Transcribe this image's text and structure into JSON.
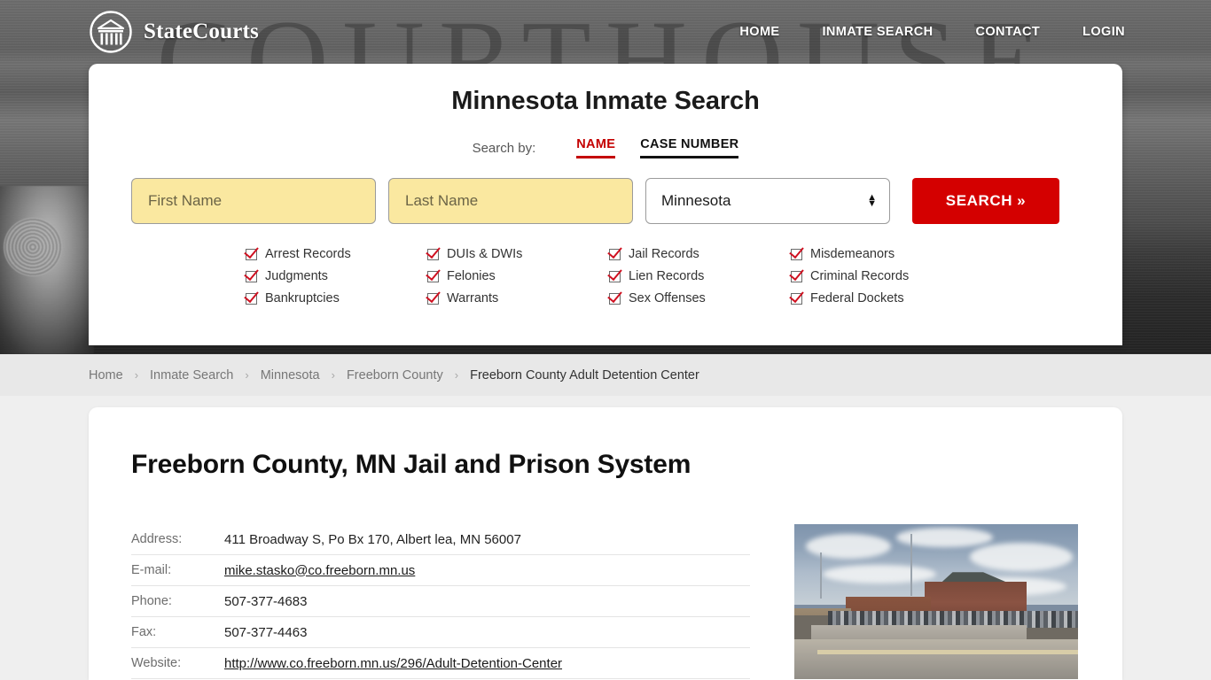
{
  "header": {
    "brand_name": "StateCourts",
    "brand_icon": "courthouse-circle-logo",
    "nav": [
      {
        "label": "HOME"
      },
      {
        "label": "INMATE SEARCH"
      },
      {
        "label": "CONTACT"
      },
      {
        "label": "LOGIN"
      }
    ]
  },
  "hero": {
    "background_word": "COURTHOUSE"
  },
  "search": {
    "title": "Minnesota Inmate Search",
    "search_by_label": "Search by:",
    "tabs": [
      {
        "label": "NAME",
        "active": true
      },
      {
        "label": "CASE NUMBER",
        "active": false
      }
    ],
    "first_name_placeholder": "First Name",
    "first_name_value": "",
    "last_name_placeholder": "Last Name",
    "last_name_value": "",
    "state_value": "Minnesota",
    "state_icon": "updown-chevron-icon",
    "search_button_label": "SEARCH",
    "search_button_chevron": "»",
    "accent_red": "#d40000",
    "field_yellow": "#fae8a0",
    "categories": [
      "Arrest Records",
      "DUIs & DWIs",
      "Jail Records",
      "Misdemeanors",
      "Judgments",
      "Felonies",
      "Lien Records",
      "Criminal Records",
      "Bankruptcies",
      "Warrants",
      "Sex Offenses",
      "Federal Dockets"
    ]
  },
  "breadcrumb": {
    "separator": "›",
    "items": [
      {
        "label": "Home",
        "current": false
      },
      {
        "label": "Inmate Search",
        "current": false
      },
      {
        "label": "Minnesota",
        "current": false
      },
      {
        "label": "Freeborn County",
        "current": false
      },
      {
        "label": "Freeborn County Adult Detention Center",
        "current": true
      }
    ]
  },
  "main": {
    "page_title": "Freeborn County, MN Jail and Prison System",
    "info_rows": [
      {
        "label": "Address:",
        "value": "411 Broadway S, Po Bx 170, Albert lea, MN 56007",
        "link": false
      },
      {
        "label": "E-mail:",
        "value": "mike.stasko@co.freeborn.mn.us",
        "link": true
      },
      {
        "label": "Phone:",
        "value": "507-377-4683",
        "link": false
      },
      {
        "label": "Fax:",
        "value": "507-377-4463",
        "link": false
      },
      {
        "label": "Website:",
        "value": "http://www.co.freeborn.mn.us/296/Adult-Detention-Center",
        "link": true
      }
    ],
    "photo_alt": "freeborn-county-adult-detention-center-photo"
  }
}
